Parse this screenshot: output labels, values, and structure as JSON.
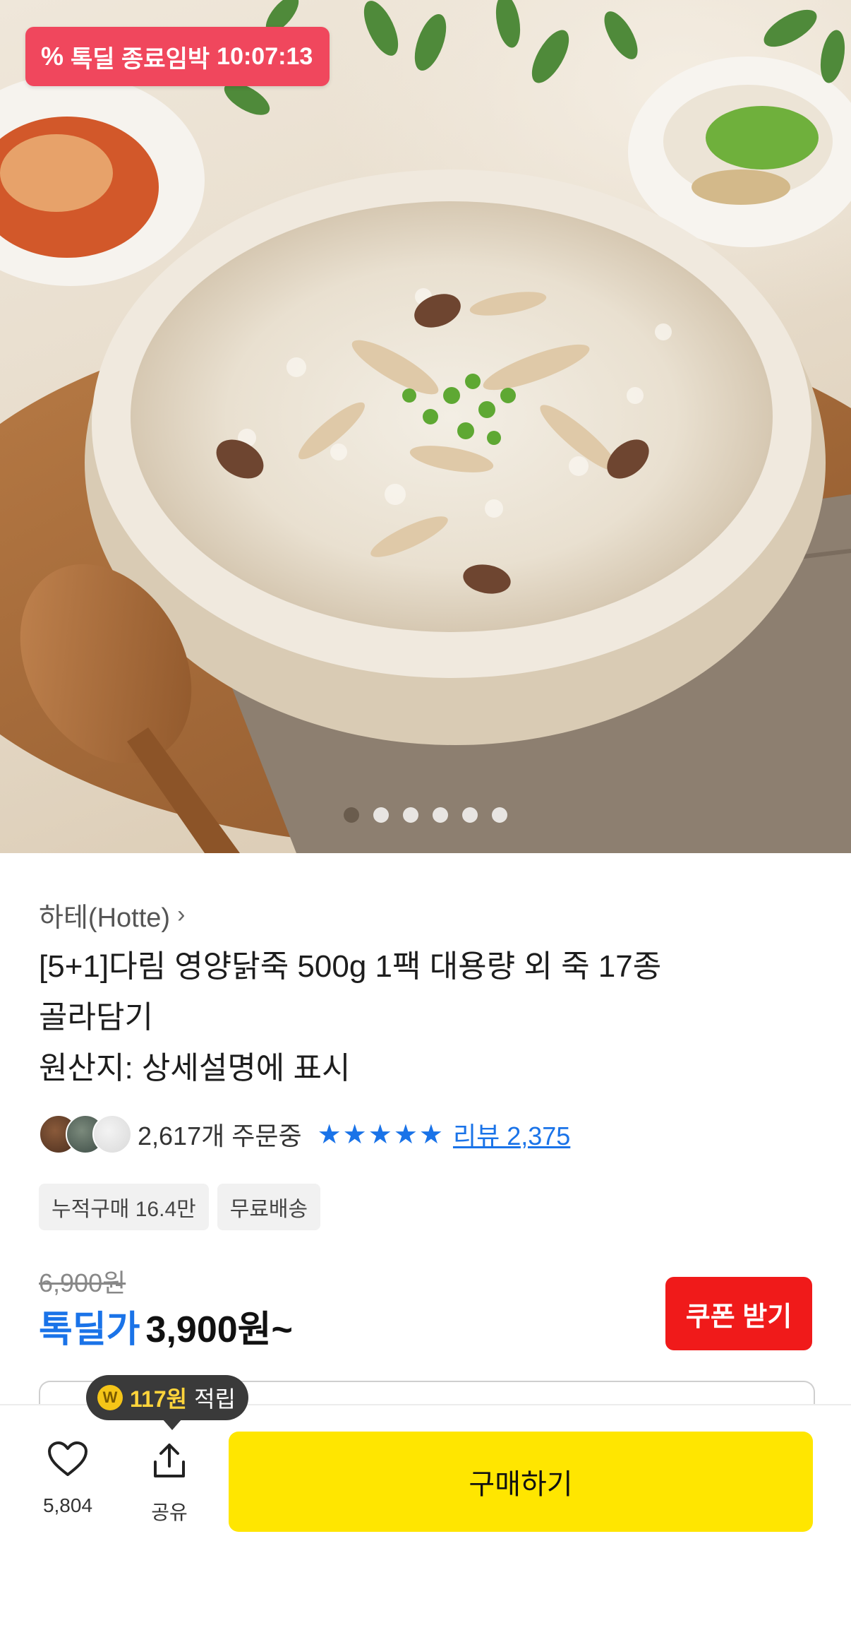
{
  "hero": {
    "badge_icon": "percent-icon",
    "badge_text": "톡딜 종료임박",
    "countdown": "10:07:13",
    "carousel_total": 6,
    "carousel_current": 1,
    "colors": {
      "badge": "#f0475d"
    }
  },
  "product": {
    "brand": "하테(Hotte)",
    "title_line1": "[5+1]다림 영양닭죽 500g 1팩 대용량 외 죽 17종",
    "title_line2": "골라담기",
    "title_line3": "원산지: 상세설명에 표시",
    "orders": "2,617개 주문중",
    "rating_stars": 5,
    "reviews": "리뷰 2,375",
    "tags": [
      "누적구매 16.4만",
      "무료배송"
    ],
    "original_price": "6,900원",
    "deal_label": "톡딜가",
    "price": "3,900원~",
    "coupon_button": "쿠폰 받기",
    "colors": {
      "accent": "#1a73e8",
      "coupon": "#f01a1a"
    }
  },
  "bottom_bar": {
    "points_amount": "117원",
    "points_label": "적립",
    "coin_glyph": "W",
    "like_count": "5,804",
    "share_label": "공유",
    "buy_button": "구매하기",
    "colors": {
      "buy": "#ffe600"
    }
  }
}
